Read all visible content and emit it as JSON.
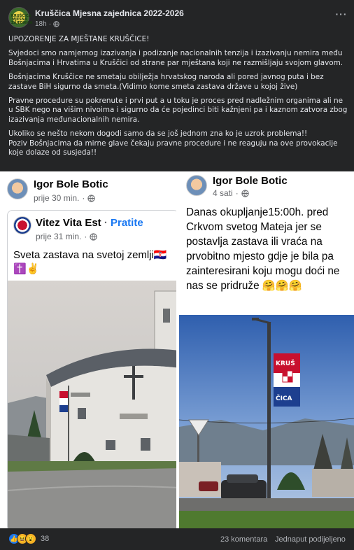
{
  "post": {
    "page_name": "Kruščica Mjesna zajednica 2022-2026",
    "time": "18h",
    "more_label": "···",
    "avatar_text": "KRUŠČICA MJESNA ZAJEDNICA",
    "paragraphs": [
      "UPOZORENJE ZA MJEŠTANE KRUŠČICE!",
      " Svjedoci smo namjernog izazivanja i podizanje nacionalnih tenzija i izazivanju nemira među Bošnjacima i Hrvatima u Kruščici od strane par mještana koji ne razmišljaju svojom glavom.",
      "Bošnjacima Kruščice ne smetaju obilježja hrvatskog naroda ali pored javnog puta i bez zastave BiH sigurno da smeta.(Vidimo kome smeta zastava države u kojoj žive)",
      "Pravne procedure su pokrenute i prvi put a u toku je proces pred nadležnim organima ali ne u SBK nego na višim nivoima i sigurno da će pojedinci biti kažnjeni pa i kaznom zatvora zbog izazivanja međunacionalnih  nemira.",
      "Ukoliko se nešto nekom dogodi samo da se još jednom zna ko je uzrok problema!!",
      "Poziv Bošnjacima da mirne glave čekaju pravne procedure i ne reaguju na ove provokacije koje dolaze od susjeda!!"
    ]
  },
  "left_image": {
    "author": "Igor Bole Botic",
    "time": "prije 30 min.",
    "shared": {
      "author": "Vitez Vita Est",
      "separator": "·",
      "follow_label": "Pratite",
      "time": "prije 31 min.",
      "text": "Sveta zastava na svetoj zemlji🇭🇷",
      "emoji_line": "✝️✌️"
    }
  },
  "right_image": {
    "author": "Igor Bole Botic",
    "time": "4 sati",
    "text": "Danas okupljanje15:00h. pred Crkvom  svetog Mateja jer se postavlja zastava ili vraća na prvobitno mjesto gdje je bila pa zainteresirani koju mogu doći ne nas se pridruže 🤗🤗🤗",
    "flag_text_top": "KRUŠ",
    "flag_text_bottom": "ČICA"
  },
  "footer": {
    "reaction_count": "38",
    "comments": "23 komentara",
    "shares": "Jednaput podijeljeno"
  },
  "colors": {
    "background": "#242526",
    "text": "#e4e6eb",
    "secondary_text": "#b0b3b8",
    "link_blue": "#1877f2"
  }
}
